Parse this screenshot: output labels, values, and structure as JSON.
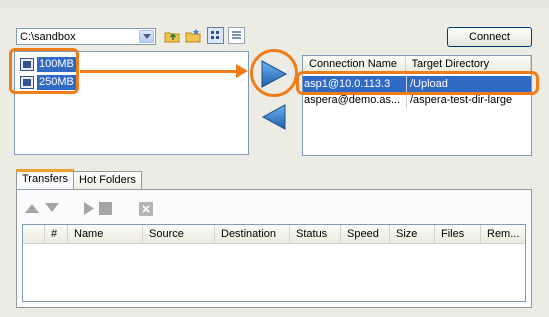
{
  "toolbar": {
    "path_value": "C:\\sandbox",
    "connect_label": "Connect"
  },
  "local_files": [
    {
      "name": "100MB",
      "icon": "file-icon"
    },
    {
      "name": "250MB",
      "icon": "file-icon"
    }
  ],
  "connections": {
    "columns": [
      "Connection Name",
      "Target Directory"
    ],
    "rows": [
      {
        "name": "asp1@10.0.113.3",
        "directory": "/Upload",
        "selected": true
      },
      {
        "name": "aspera@demo.as...",
        "directory": "/aspera-test-dir-large",
        "selected": false
      }
    ]
  },
  "tabs": [
    {
      "label": "Transfers",
      "active": true
    },
    {
      "label": "Hot Folders",
      "active": false
    }
  ],
  "transfers": {
    "columns": [
      "",
      "#",
      "Name",
      "Source",
      "Destination",
      "Status",
      "Speed",
      "Size",
      "Files",
      "Rem..."
    ]
  },
  "colors": {
    "highlight": "#f07d1a",
    "selection": "#316ac5",
    "arrow": "#2f7fcf"
  }
}
